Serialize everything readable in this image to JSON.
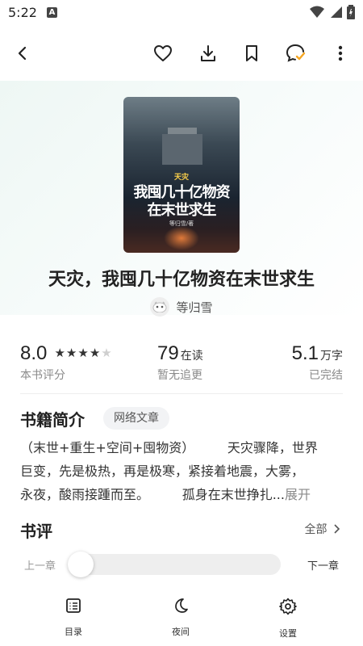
{
  "status_bar": {
    "time": "5:22",
    "badge": "A"
  },
  "toolbar": {
    "back_icon": "back-arrow-icon",
    "favorite_icon": "heart-icon",
    "download_icon": "download-icon",
    "bookmark_icon": "bookmark-icon",
    "comment_icon": "comment-icon",
    "more_icon": "more-vertical-icon"
  },
  "book": {
    "cover": {
      "tag": "天灾",
      "title_line1": "我囤几十亿物资",
      "title_line2": "在末世求生",
      "author_small": "等归雪/著"
    },
    "title": "天灾，我囤几十亿物资在末世求生",
    "author": "等归雪"
  },
  "stats": {
    "rating": {
      "value": "8.0",
      "stars": 4,
      "max_stars": 5,
      "label": "本书评分"
    },
    "readers": {
      "value": "79",
      "unit": "在读",
      "label": "暂无追更"
    },
    "words": {
      "value": "5.1",
      "unit": "万字",
      "label": "已完结"
    }
  },
  "intro": {
    "heading": "书籍简介",
    "tag": "网络文章",
    "line1": "（末世+重生+空间+囤物资）        天灾骤降，世界",
    "line2": "巨变，先是极热，再是极寒，紧接着地震，大雾，",
    "line3": "永夜，酸雨接踵而至。        孤身在末世挣扎...",
    "expand": "展开"
  },
  "reviews": {
    "heading": "书评",
    "all_label": "全部"
  },
  "chapter_nav": {
    "prev": "上一章",
    "next": "下一章",
    "progress": 0
  },
  "bottom_nav": [
    {
      "label": "目录",
      "icon": "list-icon"
    },
    {
      "label": "夜间",
      "icon": "moon-icon"
    },
    {
      "label": "设置",
      "icon": "gear-icon"
    }
  ],
  "colors": {
    "accent_check": "#f5a623",
    "text": "#222222",
    "muted": "#8a8a8a"
  }
}
